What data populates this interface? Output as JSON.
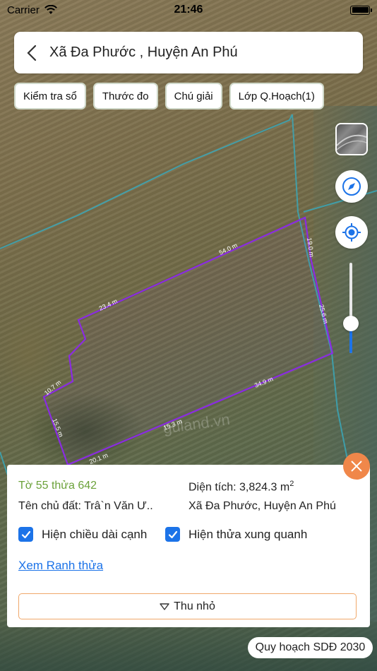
{
  "status": {
    "carrier": "Carrier",
    "time": "21:46"
  },
  "header": {
    "title": "Xã Đa Phước , Huyện An Phú"
  },
  "tools": [
    "Kiểm tra sổ",
    "Thước đo",
    "Chú giải",
    "Lớp Q.Hoạch(1)"
  ],
  "map": {
    "edges": [
      "54.0 m",
      "19.0 m",
      "23.4 m",
      "25.6 m",
      "34.9 m",
      "10.7 m",
      "15.5 m",
      "15.3 m",
      "20.1 m"
    ],
    "watermark": "guland.vn",
    "zoom_level": 0.33
  },
  "panel": {
    "parcel": "Tờ 55 thửa 642",
    "area_label": "Diện tích: 3,824.3 m",
    "area_unit_sup": "2",
    "owner": "Tên chủ đất: Trâ`n Văn Ư..",
    "location": "Xã Đa Phước, Huyện An Phú",
    "check_edge_length": "Hiện chiều dài cạnh",
    "check_neighbors": "Hiện thửa xung quanh",
    "boundary_link": "Xem Ranh thửa",
    "collapse": "Thu nhỏ"
  },
  "plan_badge": "Quy hoạch SDĐ 2030",
  "colors": {
    "accent": "#1c73e8",
    "boundary": "#8a2be2",
    "close": "#f0874a",
    "parcel_text": "#6ba23a"
  }
}
